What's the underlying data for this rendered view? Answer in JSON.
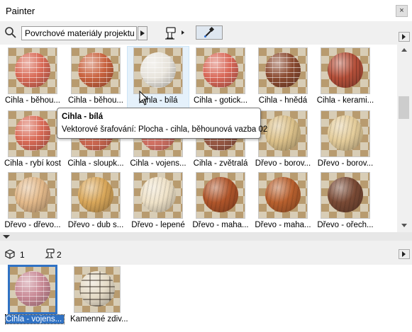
{
  "window": {
    "title": "Painter",
    "close_symbol": "×"
  },
  "toolbar": {
    "source_dropdown_value": "Povrchové materiály projektu"
  },
  "library": [
    {
      "label": "Cihla - běhou...",
      "color": "#d96a56",
      "pattern": "brick"
    },
    {
      "label": "Cihla - běhou...",
      "color": "#c9623e",
      "pattern": "brick"
    },
    {
      "label": "Cihla - bílá",
      "color": "#e8e4dc",
      "pattern": "brick",
      "selected": true
    },
    {
      "label": "Cihla - gotick...",
      "color": "#d96858",
      "pattern": "brick"
    },
    {
      "label": "Cihla - hnědá",
      "color": "#8a4a30",
      "pattern": "brick"
    },
    {
      "label": "Cihla - kerami...",
      "color": "#b5503a",
      "pattern": "stripe"
    },
    {
      "label": "Cihla - rybí kost",
      "color": "#d96a56",
      "pattern": "brick"
    },
    {
      "label": "Cihla - sloupk...",
      "color": "#d26a52",
      "pattern": "brick"
    },
    {
      "label": "Cihla - vojens...",
      "color": "#d87466",
      "pattern": "brick"
    },
    {
      "label": "Cihla - zvětralá",
      "color": "#9c5a45",
      "pattern": "brick"
    },
    {
      "label": "Dřevo - borov...",
      "color": "#dcc18a",
      "pattern": "wood"
    },
    {
      "label": "Dřevo - borov...",
      "color": "#e4cc9a",
      "pattern": "wood"
    },
    {
      "label": "Dřevo - dřevo...",
      "color": "#e3b98a",
      "pattern": "wood"
    },
    {
      "label": "Dřevo - dub s...",
      "color": "#d9a75a",
      "pattern": "wood"
    },
    {
      "label": "Dřevo - lepené",
      "color": "#efe2c8",
      "pattern": "wood"
    },
    {
      "label": "Dřevo - maha...",
      "color": "#b0552a",
      "pattern": "wood"
    },
    {
      "label": "Dřevo - maha...",
      "color": "#b8602e",
      "pattern": "wood"
    },
    {
      "label": "Dřevo - ořech...",
      "color": "#7a4a35",
      "pattern": "wood"
    }
  ],
  "tooltip": {
    "title": "Cihla - bílá",
    "body": "Vektorové šrafování: Plocha - cihla, běhounová vazba 02"
  },
  "bottom": {
    "object_count": "1",
    "paint_count": "2",
    "items": [
      {
        "label": "Cihla - vojens...",
        "color": "#c98a96",
        "pattern": "brick",
        "selected": true
      },
      {
        "label": "Kamenné zdiv...",
        "color": "#e6dcc8",
        "pattern": "stone"
      }
    ]
  },
  "icons": {
    "search": "search-icon",
    "brush": "paint-brush-icon",
    "eyedropper": "eyedropper-icon",
    "cube": "cube-icon",
    "paint": "paint-roller-icon"
  }
}
